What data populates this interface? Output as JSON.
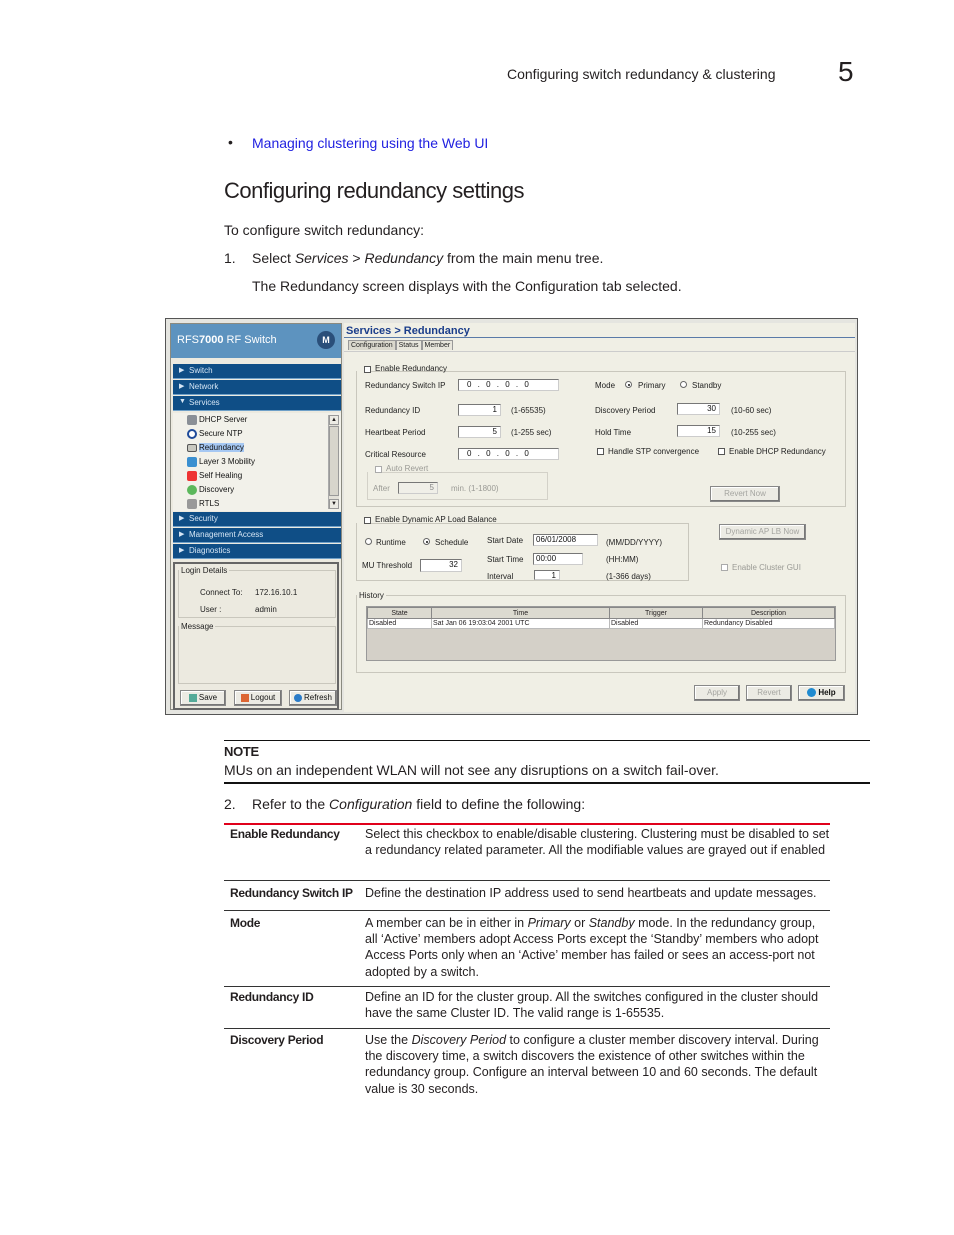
{
  "page_header": {
    "title": "Configuring switch redundancy & clustering",
    "chapter_number": "5"
  },
  "related_link": "Managing clustering using the Web UI",
  "section_title": "Configuring redundancy settings",
  "intro": "To configure switch redundancy:",
  "steps": [
    {
      "number": "1.",
      "pre": "Select ",
      "em1": "Services",
      "mid": " > ",
      "em2": "Redundancy",
      "post": " from the main menu tree."
    },
    {
      "sub": "The Redundancy screen displays with the Configuration tab selected."
    }
  ],
  "screenshot": {
    "app_title_prefix": "RFS",
    "app_title_bold": "7000",
    "app_title_suffix": " RF Switch",
    "logo_glyph": "M",
    "nav": [
      {
        "label": "Switch",
        "expanded": false
      },
      {
        "label": "Network",
        "expanded": false
      },
      {
        "label": "Services",
        "expanded": true
      },
      {
        "label": "Security",
        "expanded": false
      },
      {
        "label": "Management Access",
        "expanded": false
      },
      {
        "label": "Diagnostics",
        "expanded": false
      }
    ],
    "services_tree": [
      {
        "label": "DHCP Server",
        "icon": "server-icon"
      },
      {
        "label": "Secure NTP",
        "icon": "clock-icon"
      },
      {
        "label": "Redundancy",
        "icon": "redundancy-icon",
        "selected": true
      },
      {
        "label": "Layer 3 Mobility",
        "icon": "mobility-icon"
      },
      {
        "label": "Self Healing",
        "icon": "self-healing-icon"
      },
      {
        "label": "Discovery",
        "icon": "discovery-icon"
      },
      {
        "label": "RTLS",
        "icon": "rtls-icon"
      }
    ],
    "login": {
      "legend": "Login Details",
      "connect_label": "Connect To:",
      "connect_value": "172.16.10.1",
      "user_label": "User :",
      "user_value": "admin",
      "message_legend": "Message"
    },
    "footer_buttons": {
      "save": "Save",
      "logout": "Logout",
      "refresh": "Refresh"
    },
    "breadcrumb": "Services > Redundancy",
    "tabs": [
      "Configuration",
      "Status",
      "Member"
    ],
    "config": {
      "enable_redundancy_label": "Enable Redundancy",
      "switch_ip_label": "Redundancy Switch IP",
      "switch_ip_value": "0 . 0 . 0 . 0",
      "redundancy_id_label": "Redundancy ID",
      "redundancy_id_value": "1",
      "redundancy_id_range": "(1-65535)",
      "heartbeat_label": "Heartbeat Period",
      "heartbeat_value": "5",
      "heartbeat_range": "(1-255 sec)",
      "critical_label": "Critical Resource",
      "critical_value": "0 . 0 . 0 . 0",
      "auto_revert_label": "Auto Revert",
      "after_label": "After",
      "after_value": "5",
      "after_range": "min. (1-1800)",
      "mode_label": "Mode",
      "mode_primary": "Primary",
      "mode_standby": "Standby",
      "mode_selected": "Primary",
      "discovery_label": "Discovery Period",
      "discovery_value": "30",
      "discovery_range": "(10-60 sec)",
      "hold_label": "Hold Time",
      "hold_value": "15",
      "hold_range": "(10-255 sec)",
      "stp_label": "Handle STP convergence",
      "dhcp_label": "Enable DHCP Redundancy",
      "revert_now": "Revert Now"
    },
    "load_balance": {
      "enable_label": "Enable Dynamic AP Load Balance",
      "runtime": "Runtime",
      "schedule": "Schedule",
      "selected": "Schedule",
      "start_date_label": "Start Date",
      "start_date_value": "06/01/2008",
      "start_date_fmt": "(MM/DD/YYYY)",
      "start_time_label": "Start Time",
      "start_time_value": "00:00",
      "start_time_fmt": "(HH:MM)",
      "interval_label": "Interval",
      "interval_value": "1",
      "interval_range": "(1-366 days)",
      "mu_label": "MU Threshold",
      "mu_value": "32",
      "lb_now": "Dynamic AP LB Now",
      "cluster_gui": "Enable Cluster GUI"
    },
    "history": {
      "legend": "History",
      "columns": [
        "State",
        "Time",
        "Trigger",
        "Description"
      ],
      "rows": [
        [
          "Disabled",
          "Sat Jan 06 19:03:04 2001 UTC",
          "Disabled",
          "Redundancy Disabled"
        ]
      ]
    },
    "action_buttons": {
      "apply": "Apply",
      "revert": "Revert",
      "help": "Help"
    }
  },
  "note": {
    "heading": "NOTE",
    "text": "MUs on an independent WLAN will not see any disruptions on a switch fail-over."
  },
  "step2": {
    "number": "2.",
    "pre": "Refer to the ",
    "em": "Configuration",
    "post": " field to define the following:"
  },
  "definitions": [
    {
      "term": "Enable Redundancy",
      "def": "Select this checkbox to enable/disable clustering. Clustering must be disabled to set a redundancy related parameter. All the modifiable values are grayed out if enabled"
    },
    {
      "term": "Redundancy Switch IP",
      "def": "Define the destination IP address used to send heartbeats and update messages."
    },
    {
      "term": "Mode",
      "def_parts": [
        "A member can be in either in ",
        "Primary",
        " or ",
        "Standby",
        " mode. In the redundancy group, all ‘Active’ members adopt Access Ports except the ‘Standby’ members who adopt Access Ports only when an ‘Active’ member has failed or sees an access-port not adopted by a switch."
      ]
    },
    {
      "term": "Redundancy ID",
      "def": "Define an ID for the cluster group. All the switches configured in the cluster should have the same Cluster ID. The valid range is 1-65535."
    },
    {
      "term": "Discovery Period",
      "def_parts": [
        "Use the ",
        "Discovery Period",
        " to configure a cluster member discovery interval. During the discovery time, a switch discovers the existence of other switches within the redundancy group. Configure an interval between 10 and 60 seconds. The default value is 30 seconds."
      ]
    }
  ],
  "colors": {
    "link": "#1f1fe0",
    "table_top_rule": "#e0001b",
    "nav_bg": "#0f4e86",
    "header_bg": "#5d93bf",
    "breadcrumb": "#1a3d8a"
  }
}
